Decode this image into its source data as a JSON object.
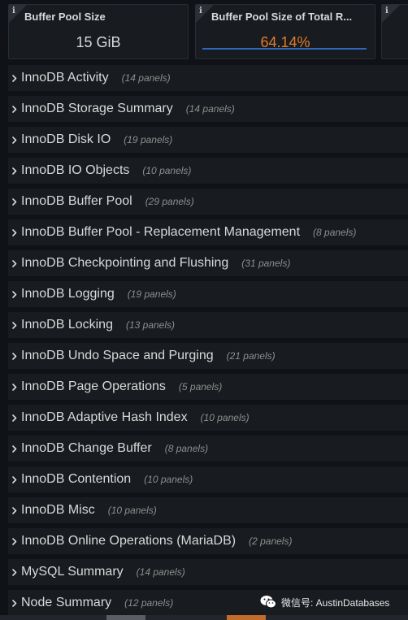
{
  "stats": [
    {
      "title": "Buffer Pool Size",
      "value": "15 GiB",
      "value_color": "#d8d9da"
    },
    {
      "title": "Buffer Pool Size of Total R...",
      "value": "64.14%",
      "value_color": "#e07c2c"
    }
  ],
  "rows": [
    {
      "label": "InnoDB Activity",
      "count": "(14 panels)"
    },
    {
      "label": "InnoDB Storage Summary",
      "count": "(14 panels)"
    },
    {
      "label": "InnoDB Disk IO",
      "count": "(19 panels)"
    },
    {
      "label": "InnoDB IO Objects",
      "count": "(10 panels)"
    },
    {
      "label": "InnoDB Buffer Pool",
      "count": "(29 panels)"
    },
    {
      "label": "InnoDB Buffer Pool - Replacement Management",
      "count": "(8 panels)"
    },
    {
      "label": "InnoDB Checkpointing and Flushing",
      "count": "(31 panels)"
    },
    {
      "label": "InnoDB Logging",
      "count": "(19 panels)"
    },
    {
      "label": "InnoDB Locking",
      "count": "(13 panels)"
    },
    {
      "label": "InnoDB Undo Space and Purging",
      "count": "(21 panels)"
    },
    {
      "label": "InnoDB Page Operations",
      "count": "(5 panels)"
    },
    {
      "label": "InnoDB Adaptive Hash Index",
      "count": "(10 panels)"
    },
    {
      "label": "InnoDB Change Buffer",
      "count": "(8 panels)"
    },
    {
      "label": "InnoDB Contention",
      "count": "(10 panels)"
    },
    {
      "label": "InnoDB Misc",
      "count": "(10 panels)"
    },
    {
      "label": "InnoDB Online Operations (MariaDB)",
      "count": "(2 panels)"
    },
    {
      "label": "MySQL Summary",
      "count": "(14 panels)"
    },
    {
      "label": "Node Summary",
      "count": "(12 panels)"
    }
  ],
  "watermark": {
    "text": "微信号: AustinDatabases",
    "icon": "wechat-icon"
  },
  "colors": {
    "background": "#111217",
    "panel": "#181b1f",
    "accent_orange": "#e07c2c",
    "accent_blue": "#3274d9"
  }
}
